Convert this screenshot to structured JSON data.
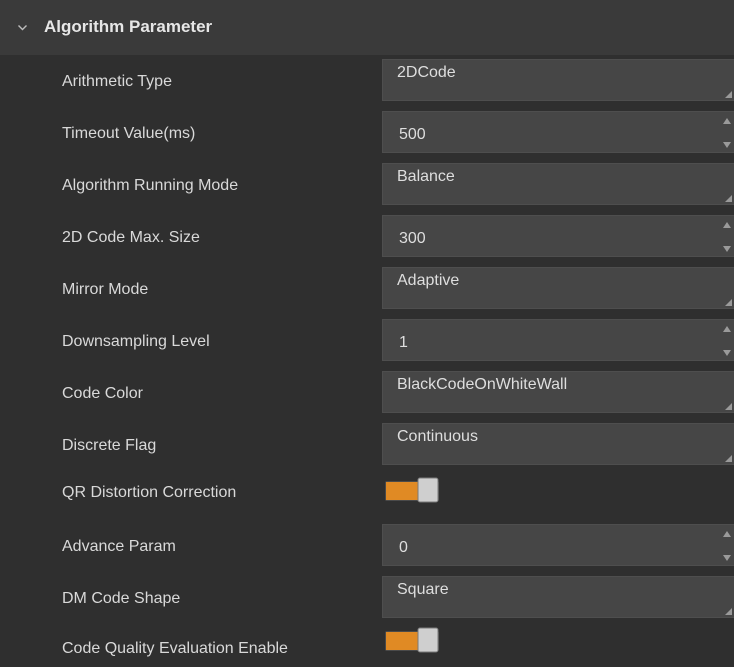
{
  "section": {
    "title": "Algorithm Parameter",
    "expanded": true
  },
  "params": [
    {
      "label": "Arithmetic Type",
      "control": "combo",
      "value": "2DCode"
    },
    {
      "label": "Timeout Value(ms)",
      "control": "spin",
      "value": "500"
    },
    {
      "label": "Algorithm Running Mode",
      "control": "combo",
      "value": "Balance"
    },
    {
      "label": "2D Code Max. Size",
      "control": "spin",
      "value": "300"
    },
    {
      "label": "Mirror Mode",
      "control": "combo",
      "value": "Adaptive"
    },
    {
      "label": "Downsampling Level",
      "control": "spin",
      "value": "1"
    },
    {
      "label": "Code Color",
      "control": "combo",
      "value": "BlackCodeOnWhiteWall"
    },
    {
      "label": "Discrete Flag",
      "control": "combo",
      "value": "Continuous"
    },
    {
      "label": "QR Distortion Correction",
      "control": "toggle",
      "on": true
    },
    {
      "label": "Advance Param",
      "control": "spin",
      "value": "0"
    },
    {
      "label": "DM Code Shape",
      "control": "combo",
      "value": "Square"
    },
    {
      "label": "Code Quality Evaluation Enable",
      "control": "toggle",
      "on": true
    }
  ],
  "colors": {
    "background": "#2f2f2f",
    "header": "#3a3a3a",
    "field": "#464646",
    "toggle_on": "#e08a24",
    "toggle_knob": "#cfcfcf"
  },
  "icons": {
    "section_toggle": "chevron-down-icon",
    "combo_grip": "resize-grip-icon",
    "spin_arrows": "spin-arrows-icon"
  }
}
